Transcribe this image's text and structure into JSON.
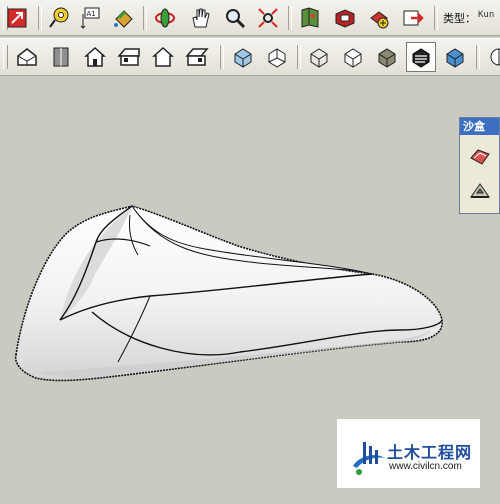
{
  "toolbar": {
    "type_label": "类型：",
    "type_value": "Kun"
  },
  "sandbox": {
    "title": "沙盒"
  },
  "watermark": {
    "site_cn": "土木工程网",
    "url": "www.civilcn.com"
  },
  "colors": {
    "background": "#c9cbc2",
    "toolbar": "#e9e8e0",
    "panel_title": "#3c6fc2",
    "model_edge": "#111111"
  },
  "icons": {
    "row1": [
      "select-icon",
      "tape-measure-icon",
      "dimension-icon",
      "paint-bucket-icon",
      "orbit-icon",
      "pan-icon",
      "zoom-icon",
      "zoom-extents-icon",
      "walk-icon",
      "components-icon",
      "layers-icon",
      "export-icon"
    ],
    "row2": [
      "iso-view-icon",
      "top-view-icon",
      "front-view-icon",
      "right-view-icon",
      "back-view-icon",
      "left-view-icon",
      "xray-icon",
      "wireframe-icon",
      "hidden-line-icon",
      "shaded-icon",
      "shaded-textures-icon",
      "monochrome-icon",
      "partial-icon"
    ]
  }
}
